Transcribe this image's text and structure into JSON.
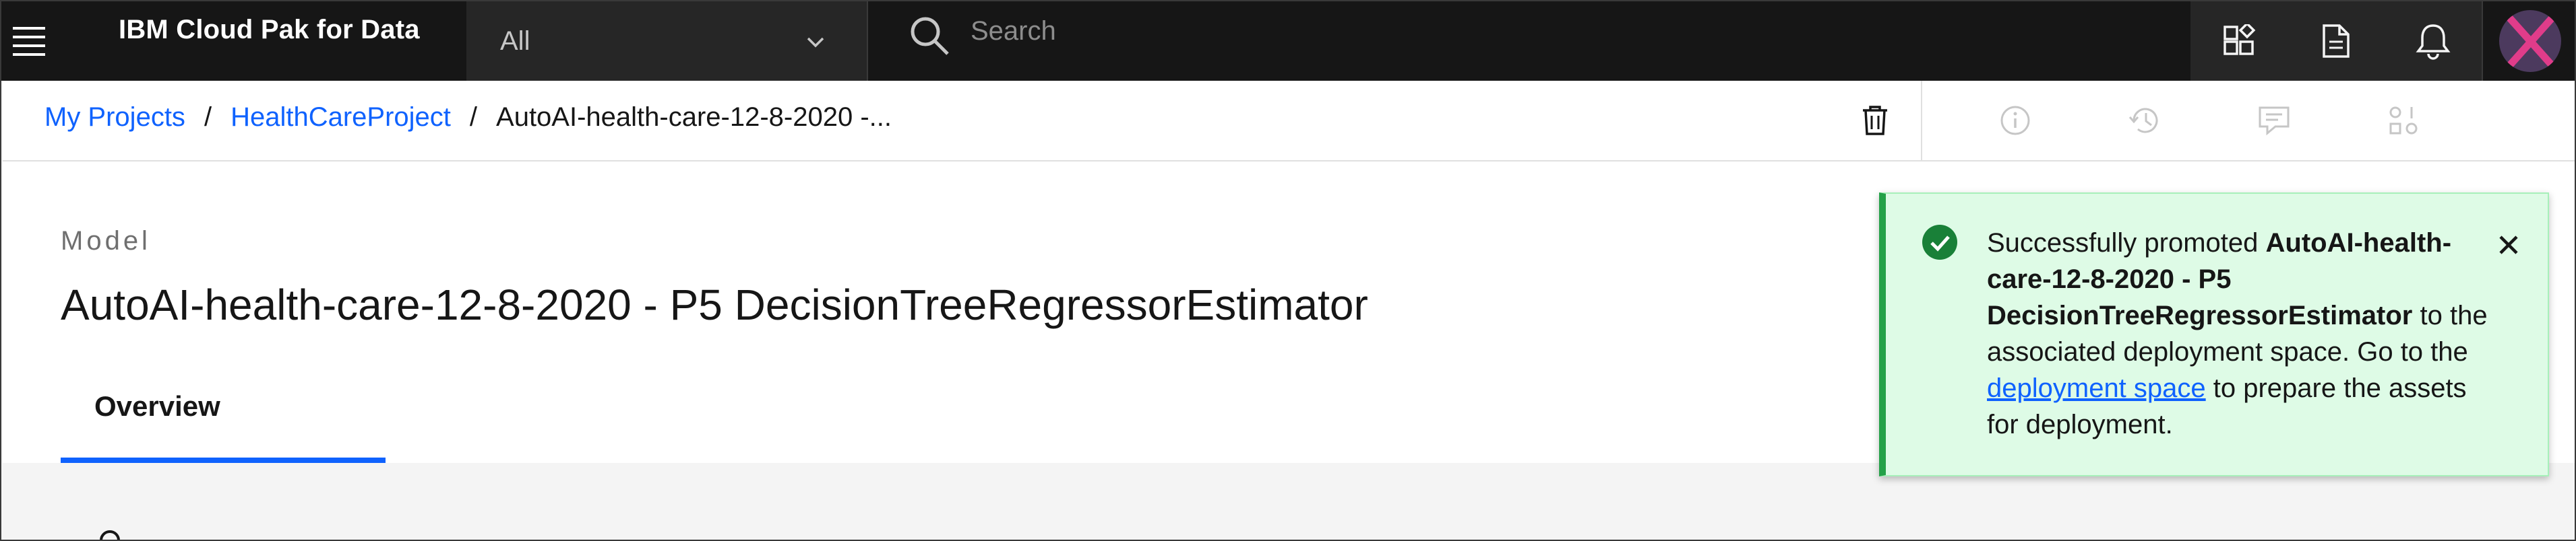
{
  "shell": {
    "brand": "IBM Cloud Pak for Data",
    "scope_value": "All",
    "search_placeholder": "Search"
  },
  "breadcrumb": {
    "items": [
      "My Projects",
      "HealthCareProject"
    ],
    "separator": "/",
    "current": "AutoAI-health-care-12-8-2020 -..."
  },
  "asset": {
    "type_label": "Model",
    "title": "AutoAI-health-care-12-8-2020 - P5 DecisionTreeRegressorEstimator",
    "tabs": [
      {
        "label": "Overview",
        "selected": true
      }
    ]
  },
  "toast": {
    "kind": "success",
    "prefix": "Successfully promoted ",
    "asset_name": "AutoAI-health-care-12-8-2020 - P5 DecisionTreeRegressorEstimator",
    "middle": " to the associated deployment space. Go to the ",
    "link_text": "deployment space",
    "suffix": " to prepare the assets for deployment."
  },
  "icons": {
    "shell": [
      "hamburger-icon",
      "chevron-down-icon",
      "search-icon",
      "apps-icon",
      "document-icon",
      "notification-bell-icon",
      "user-avatar-icon"
    ],
    "subheader": [
      "trash-icon",
      "info-icon",
      "history-icon",
      "comments-icon",
      "related-assets-icon"
    ]
  },
  "colors": {
    "accent": "#0f62fe",
    "shell_bg": "#161616",
    "success": "#24a148",
    "success_bg": "#defbe6"
  }
}
